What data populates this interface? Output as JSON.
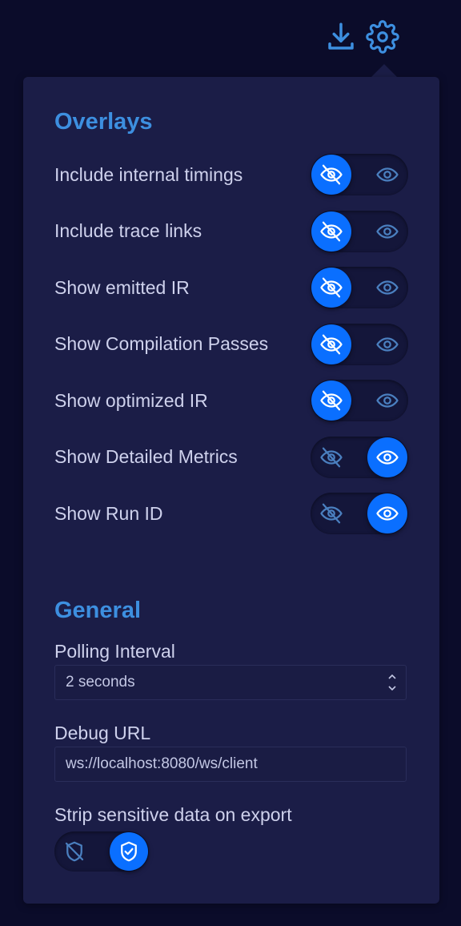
{
  "icons": {
    "download": "download-icon",
    "settings": "gear-icon",
    "hidden": "eye-off-icon",
    "visible": "eye-icon",
    "shield_off": "shield-off-icon",
    "shield_check": "shield-check-icon"
  },
  "colors": {
    "accent": "#0a6fff",
    "heading": "#3d8fe0",
    "panel": "#1b1d47",
    "background": "#0b0c2a"
  },
  "overlays": {
    "title": "Overlays",
    "items": [
      {
        "label": "Include internal timings",
        "state": "hidden"
      },
      {
        "label": "Include trace links",
        "state": "hidden"
      },
      {
        "label": "Show emitted IR",
        "state": "hidden"
      },
      {
        "label": "Show Compilation Passes",
        "state": "hidden"
      },
      {
        "label": "Show optimized IR",
        "state": "hidden"
      },
      {
        "label": "Show Detailed Metrics",
        "state": "visible"
      },
      {
        "label": "Show Run ID",
        "state": "visible"
      }
    ]
  },
  "general": {
    "title": "General",
    "polling_label": "Polling Interval",
    "polling_value": "2 seconds",
    "debug_label": "Debug URL",
    "debug_value": "ws://localhost:8080/ws/client",
    "strip_label": "Strip sensitive data on export",
    "strip_enabled": true
  }
}
